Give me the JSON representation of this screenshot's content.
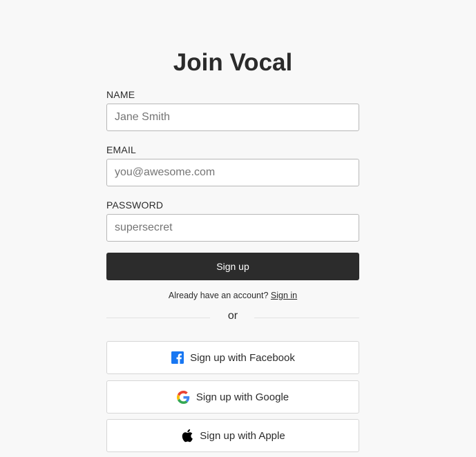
{
  "page": {
    "title": "Join Vocal"
  },
  "form": {
    "name": {
      "label": "NAME",
      "placeholder": "Jane Smith"
    },
    "email": {
      "label": "EMAIL",
      "placeholder": "you@awesome.com"
    },
    "password": {
      "label": "PASSWORD",
      "placeholder": "supersecret"
    },
    "submit_label": "Sign up"
  },
  "signin": {
    "prompt": "Already have an account?",
    "link_label": "Sign in"
  },
  "divider": {
    "label": "or"
  },
  "social": {
    "facebook": {
      "label": "Sign up with Facebook",
      "icon": "facebook-icon",
      "color": "#1877f2"
    },
    "google": {
      "label": "Sign up with Google",
      "icon": "google-icon"
    },
    "apple": {
      "label": "Sign up with Apple",
      "icon": "apple-icon",
      "color": "#000000"
    }
  },
  "colors": {
    "background": "#f8f8f8",
    "primary_button": "#2c2c2c",
    "text": "#2b2b2b"
  }
}
